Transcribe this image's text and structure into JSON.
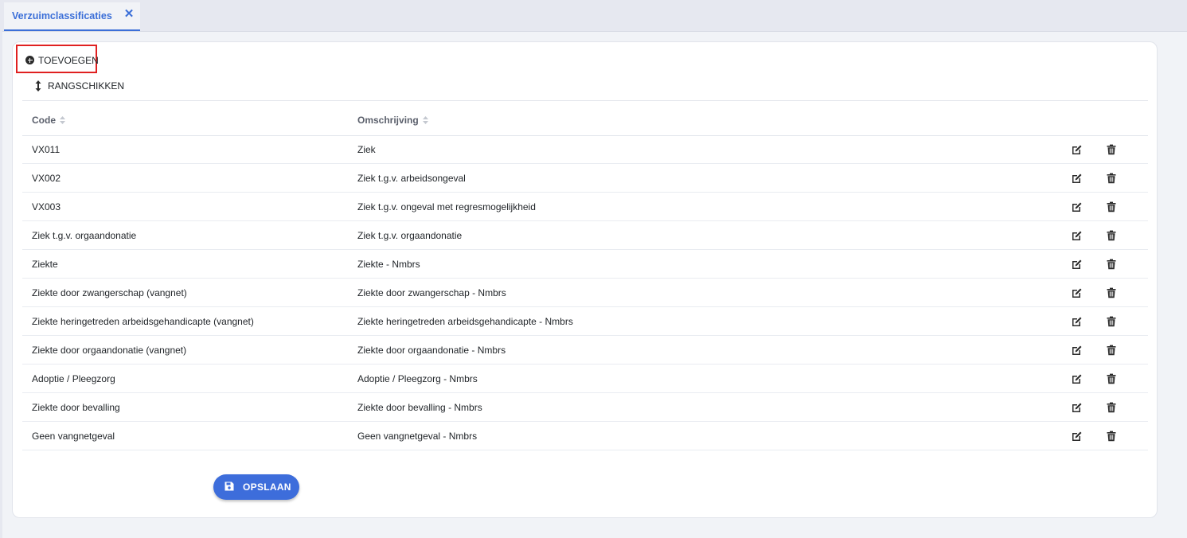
{
  "tab": {
    "label": "Verzuimclassificaties",
    "close_icon": "close-icon"
  },
  "toolbar": {
    "add_label": "TOEVOEGEN",
    "add_icon": "plus-circle-icon",
    "rank_label": "RANGSCHIKKEN",
    "rank_icon": "sort-arrows-icon"
  },
  "table": {
    "columns": [
      "Code",
      "Omschrijving"
    ],
    "rows": [
      {
        "code": "VX011",
        "desc": "Ziek"
      },
      {
        "code": "VX002",
        "desc": "Ziek t.g.v. arbeidsongeval"
      },
      {
        "code": "VX003",
        "desc": "Ziek t.g.v. ongeval met regresmogelijkheid"
      },
      {
        "code": "Ziek t.g.v. orgaandonatie",
        "desc": "Ziek t.g.v. orgaandonatie"
      },
      {
        "code": "Ziekte",
        "desc": "Ziekte - Nmbrs"
      },
      {
        "code": "Ziekte door zwangerschap (vangnet)",
        "desc": "Ziekte door zwangerschap - Nmbrs"
      },
      {
        "code": "Ziekte heringetreden arbeidsgehandicapte (vangnet)",
        "desc": "Ziekte heringetreden arbeidsgehandicapte - Nmbrs"
      },
      {
        "code": "Ziekte door orgaandonatie (vangnet)",
        "desc": "Ziekte door orgaandonatie - Nmbrs"
      },
      {
        "code": "Adoptie / Pleegzorg",
        "desc": "Adoptie / Pleegzorg - Nmbrs"
      },
      {
        "code": "Ziekte door bevalling",
        "desc": "Ziekte door bevalling - Nmbrs"
      },
      {
        "code": "Geen vangnetgeval",
        "desc": "Geen vangnetgeval - Nmbrs"
      }
    ]
  },
  "save": {
    "label": "OPSLAAN",
    "icon": "floppy-disk-icon"
  },
  "colors": {
    "accent": "#3b6fd8",
    "save_button": "#3d6ddb",
    "highlight_border": "#e02020",
    "icon": "#2b2b2b"
  }
}
